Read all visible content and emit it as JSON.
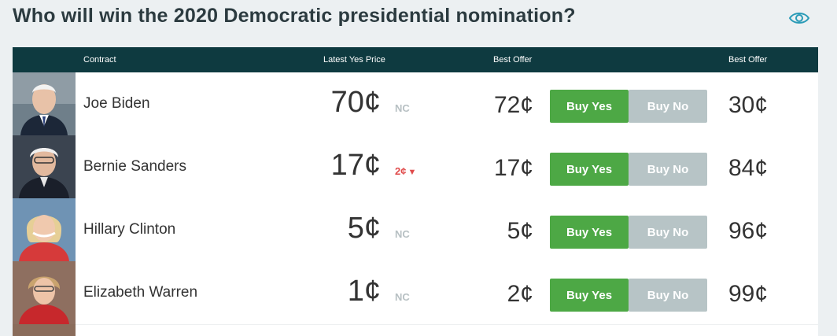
{
  "page": {
    "title": "Who will win the 2020 Democratic presidential nomination?"
  },
  "table": {
    "headers": {
      "contract": "Contract",
      "latest_yes_price": "Latest Yes Price",
      "best_offer_yes": "Best Offer",
      "best_offer_no": "Best Offer"
    },
    "rows": [
      {
        "name": "Joe Biden",
        "price": "70¢",
        "change": "NC",
        "change_dir": "none",
        "yes_offer": "72¢",
        "buy_yes": "Buy Yes",
        "buy_no": "Buy No",
        "no_offer": "30¢"
      },
      {
        "name": "Bernie Sanders",
        "price": "17¢",
        "change": "2¢",
        "change_dir": "down",
        "yes_offer": "17¢",
        "buy_yes": "Buy Yes",
        "buy_no": "Buy No",
        "no_offer": "84¢"
      },
      {
        "name": "Hillary Clinton",
        "price": "5¢",
        "change": "NC",
        "change_dir": "none",
        "yes_offer": "5¢",
        "buy_yes": "Buy Yes",
        "buy_no": "Buy No",
        "no_offer": "96¢"
      },
      {
        "name": "Elizabeth Warren",
        "price": "1¢",
        "change": "NC",
        "change_dir": "none",
        "yes_offer": "2¢",
        "buy_yes": "Buy Yes",
        "buy_no": "Buy No",
        "no_offer": "99¢"
      }
    ]
  },
  "colors": {
    "header_bg": "#0e3a40",
    "buy_yes": "#4da845",
    "buy_no": "#b7c4c6",
    "down": "#e04b4b",
    "eye_icon": "#2a9bb7"
  },
  "icons": {
    "watch": "eye-icon",
    "price_down": "arrow-down-icon"
  }
}
